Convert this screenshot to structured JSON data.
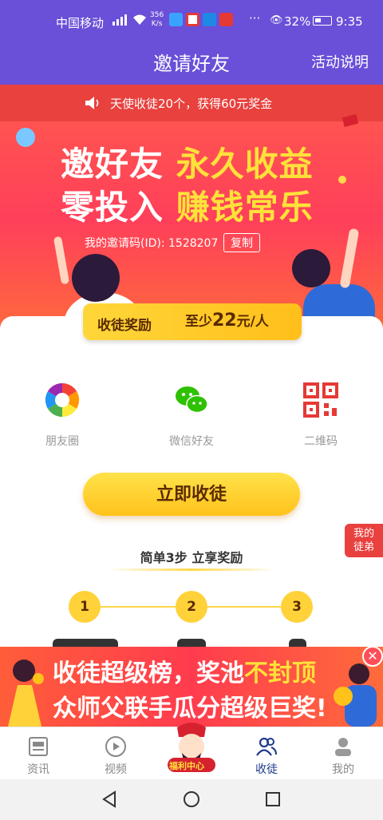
{
  "status_bar": {
    "carrier": "中国移动",
    "net_speed_value": "356",
    "net_speed_unit": "K/s",
    "dots": "···",
    "battery": "32%",
    "time": "9:35"
  },
  "header": {
    "title": "邀请好友",
    "rules_link": "活动说明"
  },
  "notice": {
    "text": "天使收徒20个，获得60元奖金"
  },
  "hero": {
    "slogan_line1_a": "邀好友",
    "slogan_line1_b": "永久收益",
    "slogan_line2_a": "零投入",
    "slogan_line2_b": "赚钱常乐",
    "invite_code_label": "我的邀请码(ID): 1528207",
    "copy_button": "复制"
  },
  "reward": {
    "label": "收徒奖励",
    "prefix": "至少",
    "amount": "22",
    "suffix": "元/人"
  },
  "share_options": [
    {
      "label": "朋友圈",
      "icon": "moments-icon"
    },
    {
      "label": "微信好友",
      "icon": "wechat-icon"
    },
    {
      "label": "二维码",
      "icon": "qrcode-icon"
    }
  ],
  "main_button": "立即收徒",
  "steps": {
    "title": "简单3步  立享奖励",
    "numbers": [
      "1",
      "2",
      "3"
    ]
  },
  "side_tag": {
    "line1": "我的",
    "line2": "徒弟"
  },
  "banner": {
    "line1_a": "收徒超级榜，奖池",
    "line1_b": "不封顶",
    "line2": "众师父联手瓜分超级巨奖!",
    "close": "✕"
  },
  "bottom_nav": [
    {
      "label": "资讯",
      "icon": "news-icon",
      "active": false
    },
    {
      "label": "视频",
      "icon": "video-play-icon",
      "active": false
    },
    {
      "label": "福利中心",
      "icon": "fortune-god-icon",
      "active": false
    },
    {
      "label": "收徒",
      "icon": "people-icon",
      "active": true
    },
    {
      "label": "我的",
      "icon": "profile-icon",
      "active": false
    }
  ],
  "colors": {
    "header_purple": "#6a4fd8",
    "hero_red": "#ff3f5a",
    "gold": "#ffd23a",
    "active_nav": "#1e3a8a"
  }
}
